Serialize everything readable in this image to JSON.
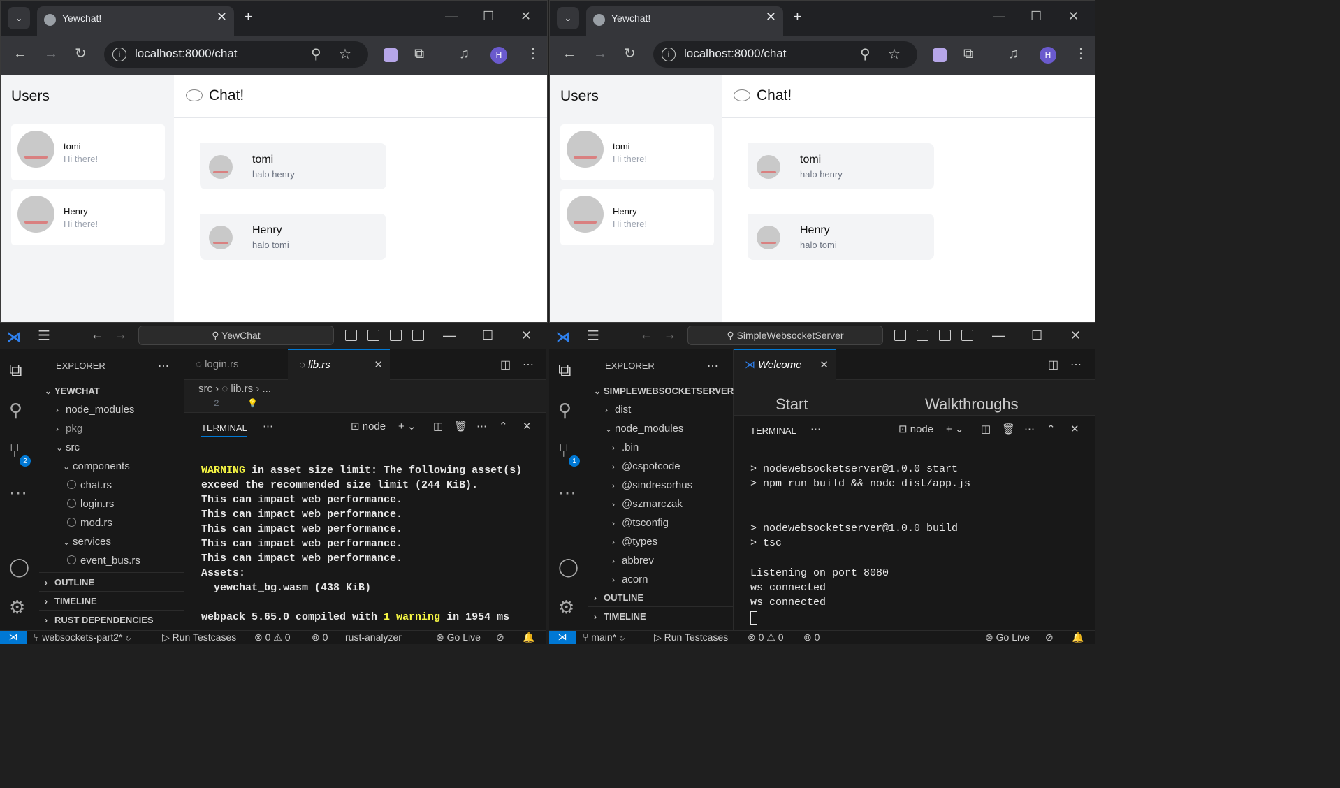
{
  "browsers": [
    {
      "tab_title": "Yewchat!",
      "url": "localhost:8000/chat",
      "profile_initial": "H",
      "users_heading": "Users",
      "chat_heading": "Chat!",
      "users": [
        {
          "name": "tomi",
          "message": "Hi there!"
        },
        {
          "name": "Henry",
          "message": "Hi there!"
        }
      ],
      "messages": [
        {
          "from": "tomi",
          "text": "halo henry"
        },
        {
          "from": "Henry",
          "text": "halo tomi"
        }
      ]
    },
    {
      "tab_title": "Yewchat!",
      "url": "localhost:8000/chat",
      "profile_initial": "H",
      "users_heading": "Users",
      "chat_heading": "Chat!",
      "users": [
        {
          "name": "tomi",
          "message": "Hi there!"
        },
        {
          "name": "Henry",
          "message": "Hi there!"
        }
      ],
      "messages": [
        {
          "from": "tomi",
          "text": "halo henry"
        },
        {
          "from": "Henry",
          "text": "halo tomi"
        }
      ]
    }
  ],
  "vscode_left": {
    "search": "YewChat",
    "explorer_label": "EXPLORER",
    "root": "YEWCHAT",
    "tree": [
      "node_modules",
      "pkg",
      "src",
      "components",
      "chat.rs",
      "login.rs",
      "mod.rs",
      "services",
      "event_bus.rs"
    ],
    "sections": [
      "OUTLINE",
      "TIMELINE",
      "RUST DEPENDENCIES"
    ],
    "tabs": [
      "login.rs",
      "lib.rs"
    ],
    "breadcrumb": [
      "src",
      "lib.rs",
      "..."
    ],
    "line_number": "2",
    "terminal_tab": "TERMINAL",
    "terminal_shell": "node",
    "terminal_lines": {
      "l1a": "WARNING",
      "l1b": " in asset size limit: The following asset(s)",
      "l2": "exceed the recommended size limit (244 KiB).",
      "l3": "This can impact web performance.",
      "l4": "This can impact web performance.",
      "l5": "This can impact web performance.",
      "l6": "This can impact web performance.",
      "l7": "This can impact web performance.",
      "l8": "Assets:",
      "l9": "  yewchat_bg.wasm (438 KiB)",
      "l10a": "webpack 5.65.0 compiled with ",
      "l10b": "1 warning",
      "l10c": " in 1954 ms"
    },
    "scm_badge": "2",
    "status": {
      "branch": "websockets-part2*",
      "run": "Run Testcases",
      "errors": "0",
      "warnings": "0",
      "ports": "0",
      "analyzer": "rust-analyzer",
      "golive": "Go Live"
    }
  },
  "vscode_right": {
    "search": "SimpleWebsocketServer",
    "explorer_label": "EXPLORER",
    "root": "SIMPLEWEBSOCKETSERVER",
    "tree": [
      "dist",
      "node_modules",
      ".bin",
      "@cspotcode",
      "@sindresorhus",
      "@szmarczak",
      "@tsconfig",
      "@types",
      "abbrev",
      "acorn"
    ],
    "sections": [
      "OUTLINE",
      "TIMELINE"
    ],
    "tabs": [
      "Welcome"
    ],
    "welcome_start": "Start",
    "welcome_walkthroughs": "Walkthroughs",
    "terminal_tab": "TERMINAL",
    "terminal_shell": "node",
    "terminal_lines": {
      "l1": "> nodewebsocketserver@1.0.0 start",
      "l2": "> npm run build && node dist/app.js",
      "l3": "> nodewebsocketserver@1.0.0 build",
      "l4": "> tsc",
      "l5": "Listening on port 8080",
      "l6": "ws connected",
      "l7": "ws connected"
    },
    "scm_badge": "1",
    "status": {
      "branch": "main*",
      "run": "Run Testcases",
      "errors": "0",
      "warnings": "0",
      "ports": "0",
      "golive": "Go Live"
    }
  }
}
